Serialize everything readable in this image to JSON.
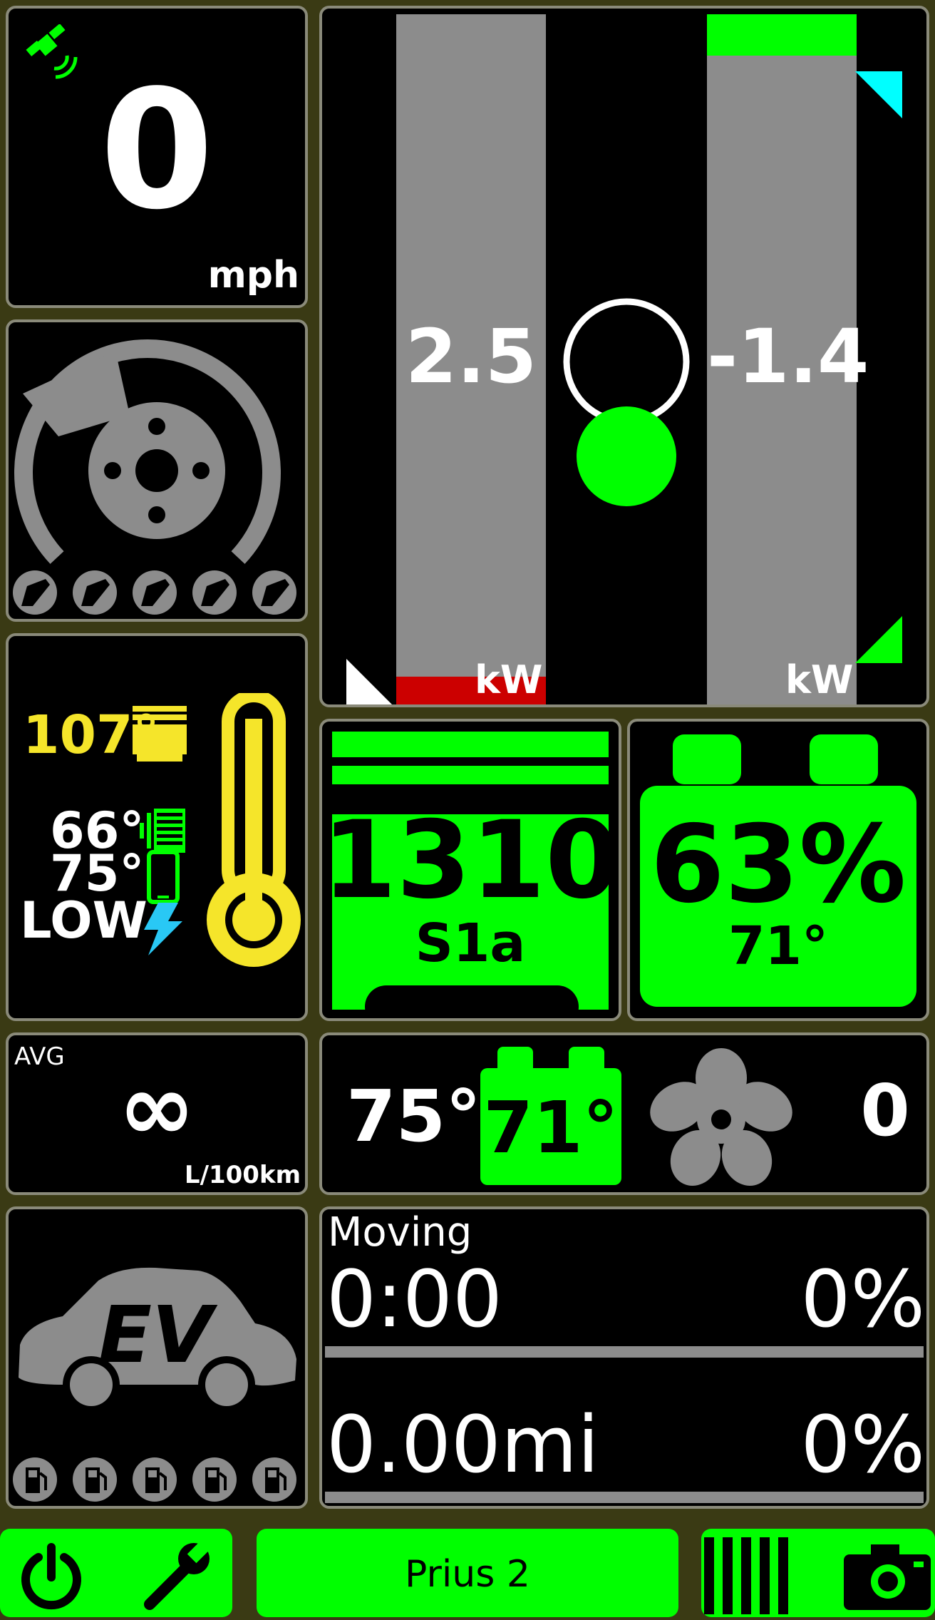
{
  "speed": {
    "value": "0",
    "unit": "mph",
    "icon": "satellite-icon"
  },
  "brake": {
    "icon": "brake-disc-icon",
    "indicators": [
      "brake-pad-icon",
      "brake-pad-icon",
      "brake-pad-icon",
      "brake-pad-icon",
      "brake-pad-icon"
    ]
  },
  "power": {
    "left_value": "2.5",
    "left_unit": "kW",
    "right_value": "-1.4",
    "right_unit": "kW",
    "left_fill_fraction": 0.04,
    "right_fill_fraction": 0.06
  },
  "temps": {
    "engine": "107°",
    "intake": "66°",
    "battery": "75°",
    "charge": "LOW"
  },
  "engine_card": {
    "value": "1310",
    "label": "S1a"
  },
  "battery_card": {
    "value": "63%",
    "temp": "71°"
  },
  "avg": {
    "label": "AVG",
    "value": "∞",
    "unit": "L/100km"
  },
  "climate": {
    "outside": "75°",
    "battery": "71°",
    "fan": "0"
  },
  "trip": {
    "label": "Moving",
    "time": "0:00",
    "time_pct": "0%",
    "distance": "0.00mi",
    "distance_pct": "0%"
  },
  "ev": {
    "icon": "ev-car-icon",
    "indicators": [
      "fuel-icon",
      "fuel-icon",
      "fuel-icon",
      "fuel-icon",
      "fuel-icon"
    ]
  },
  "tabs": {
    "center_label": "Prius 2"
  },
  "colors": {
    "accent": "#00ff00",
    "warning": "#f5e52a",
    "panel_border": "#8a8a7a",
    "background": "#3a3a14",
    "regen": "#00ffff",
    "limit": "#cc0000"
  }
}
